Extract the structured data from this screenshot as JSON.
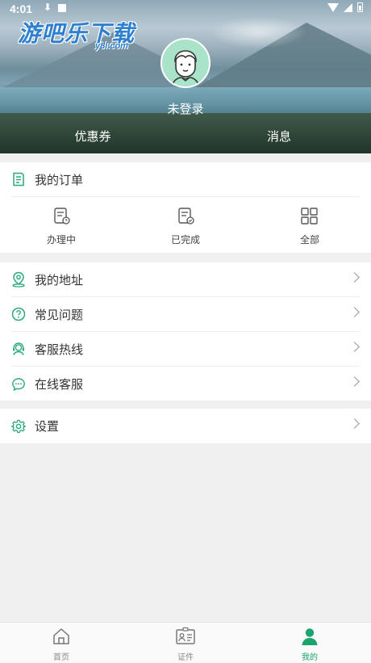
{
  "status_bar": {
    "time": "4:01"
  },
  "watermark": {
    "brand": "游吧乐下载",
    "domain": "y8l.com"
  },
  "profile": {
    "login_status": "未登录"
  },
  "header_tabs": {
    "coupon": "优惠券",
    "messages": "消息"
  },
  "orders": {
    "title": "我的订单",
    "items": [
      {
        "label": "办理中",
        "icon": "document-clock-icon"
      },
      {
        "label": "已完成",
        "icon": "document-check-icon"
      },
      {
        "label": "全部",
        "icon": "grid-icon"
      }
    ]
  },
  "menu": {
    "items": [
      {
        "label": "我的地址",
        "icon": "location-pin-icon"
      },
      {
        "label": "常见问题",
        "icon": "question-icon"
      },
      {
        "label": "客服热线",
        "icon": "headset-icon"
      },
      {
        "label": "在线客服",
        "icon": "chat-icon"
      }
    ]
  },
  "settings": {
    "label": "设置",
    "icon": "gear-icon"
  },
  "bottom_nav": {
    "items": [
      {
        "label": "首页",
        "icon": "home-icon",
        "active": false
      },
      {
        "label": "证件",
        "icon": "id-card-icon",
        "active": false
      },
      {
        "label": "我的",
        "icon": "person-icon",
        "active": true
      }
    ]
  },
  "colors": {
    "accent": "#1ba46c",
    "icon_green": "#2aaa77",
    "background": "#f0f0f0",
    "avatar_bg": "#a9e3c9"
  }
}
